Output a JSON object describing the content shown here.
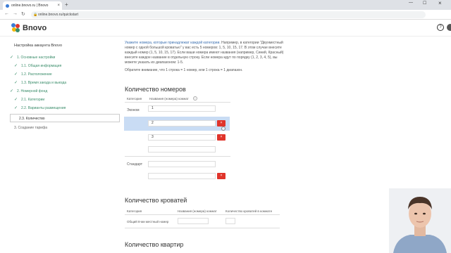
{
  "browser": {
    "tab_title": "online.bnovo.ru | Bnovo",
    "tab_close": "×",
    "new_tab": "+",
    "url": "online.bnovo.ru/quickstart",
    "lock_icon": "🔒",
    "back_icon": "←",
    "forward_icon": "→",
    "reload_icon": "↻",
    "win_min": "—",
    "win_max": "☐",
    "win_close": "×"
  },
  "app": {
    "logo_text": "Bnovo",
    "help_label": "?",
    "colors": {
      "accent_green": "#3a8d6a",
      "danger_red": "#e0342b",
      "link_blue": "#3a6fb0",
      "selection_blue": "#c9dcf4"
    }
  },
  "sidebar": {
    "title": "Настройка аккаунта Bnovo",
    "check": "✓",
    "items": [
      {
        "label": "1. Основные настройки",
        "done": true
      },
      {
        "label": "1.1. Общая информация",
        "done": true
      },
      {
        "label": "1.2. Расположение",
        "done": true
      },
      {
        "label": "1.3. Время заезда и выезда",
        "done": true
      },
      {
        "label": "2. Номерной фонд",
        "done": true
      },
      {
        "label": "2.1. Категории",
        "done": true
      },
      {
        "label": "2.2. Варианты размещения",
        "done": true
      },
      {
        "label": "2.3. Количество",
        "done": false
      },
      {
        "label": "3. Создание тарифа",
        "done": false
      }
    ]
  },
  "main": {
    "intro_highlight": "Укажите номера, которые принадлежат каждой категории.",
    "intro_rest": " Например, в категории \"Двухместный номер с одной большой кроватью\" у вас есть 5 номеров: 1, 5, 10, 15, 17. В этом случае внесите каждый номер (1, 5, 10, 15, 17). Если ваши номера имеют названия (например, Синий, Красный) внесите каждое название в отдельную строку. Если номера идут по порядку (1, 2, 3, 4, 5), вы можете указать их диапазоном: 1-5.",
    "note": "Обратите внимание, что 1 строка = 1 номер, или 1 строка = 1 диапазон.",
    "rooms": {
      "heading": "Количество номеров",
      "col_category": "Категория",
      "col_names": "Названия (номера) комнат",
      "info_icon": "i",
      "categories": [
        {
          "name": "Эконом",
          "values": [
            "1",
            "2",
            "3",
            ""
          ]
        },
        {
          "name": "Стандарт",
          "values": [
            "",
            ""
          ]
        }
      ],
      "delete_icon": "×"
    },
    "beds": {
      "heading": "Количество кроватей",
      "col_category": "Категория",
      "col_names": "Названия (номера) комнат",
      "col_beds": "Количество кроватей в комнате",
      "row_label": "Общий 8-ми местный номер"
    },
    "apartments": {
      "heading": "Количество квартир"
    }
  }
}
